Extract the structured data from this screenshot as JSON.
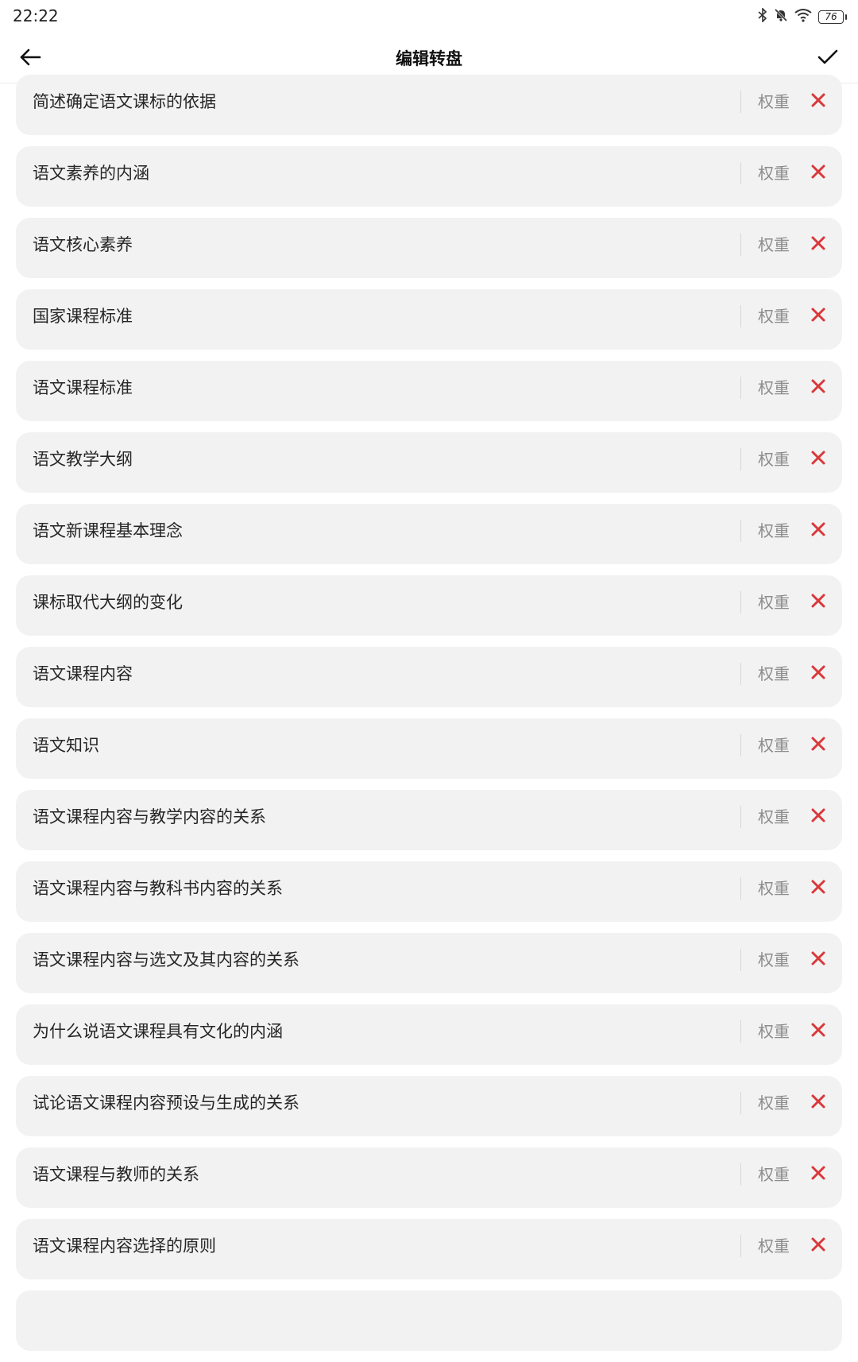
{
  "status_bar": {
    "time": "22:22",
    "battery": "76",
    "icons": [
      "bluetooth-icon",
      "mute-bell-icon",
      "wifi-icon",
      "battery-icon"
    ]
  },
  "app_bar": {
    "title": "编辑转盘",
    "back_icon": "arrow-left-icon",
    "confirm_icon": "check-icon"
  },
  "colors": {
    "delete": "#d9383a",
    "item_bg": "#f2f2f2",
    "weight_text": "#8c8c8c"
  },
  "items": [
    {
      "label": "简述确定语文课标的依据",
      "weight_label": "权重"
    },
    {
      "label": "语文素养的内涵",
      "weight_label": "权重"
    },
    {
      "label": "语文核心素养",
      "weight_label": "权重"
    },
    {
      "label": "国家课程标准",
      "weight_label": "权重"
    },
    {
      "label": "语文课程标准",
      "weight_label": "权重"
    },
    {
      "label": "语文教学大纲",
      "weight_label": "权重"
    },
    {
      "label": "语文新课程基本理念",
      "weight_label": "权重"
    },
    {
      "label": "课标取代大纲的变化",
      "weight_label": "权重"
    },
    {
      "label": "语文课程内容",
      "weight_label": "权重"
    },
    {
      "label": "语文知识",
      "weight_label": "权重"
    },
    {
      "label": "语文课程内容与教学内容的关系",
      "weight_label": "权重"
    },
    {
      "label": "语文课程内容与教科书内容的关系",
      "weight_label": "权重"
    },
    {
      "label": "语文课程内容与选文及其内容的关系",
      "weight_label": "权重"
    },
    {
      "label": "为什么说语文课程具有文化的内涵",
      "weight_label": "权重"
    },
    {
      "label": "试论语文课程内容预设与生成的关系",
      "weight_label": "权重"
    },
    {
      "label": "语文课程与教师的关系",
      "weight_label": "权重"
    },
    {
      "label": "语文课程内容选择的原则",
      "weight_label": "权重"
    }
  ]
}
